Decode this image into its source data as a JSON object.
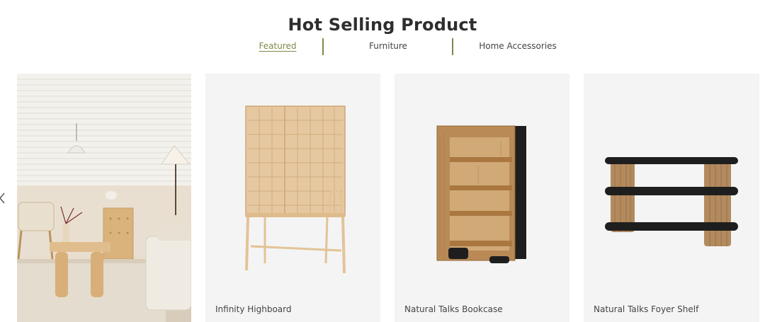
{
  "section": {
    "title": "Hot Selling Product"
  },
  "tabs": [
    {
      "label": "Featured",
      "active": true
    },
    {
      "label": "Furniture",
      "active": false
    },
    {
      "label": "Home Accessories",
      "active": false
    }
  ],
  "carousel": {
    "prev_icon": "chevron-left-icon"
  },
  "products": [
    {
      "name": "Infinity Highboard",
      "image": "wooden-cabinet"
    },
    {
      "name": "Natural Talks Bookcase",
      "image": "wooden-bookcase"
    },
    {
      "name": "Natural Talks Foyer Shelf",
      "image": "foyer-shelf"
    }
  ],
  "colors": {
    "accent": "#7d8a48",
    "card_bg": "#f4f4f4",
    "text": "#444444"
  }
}
